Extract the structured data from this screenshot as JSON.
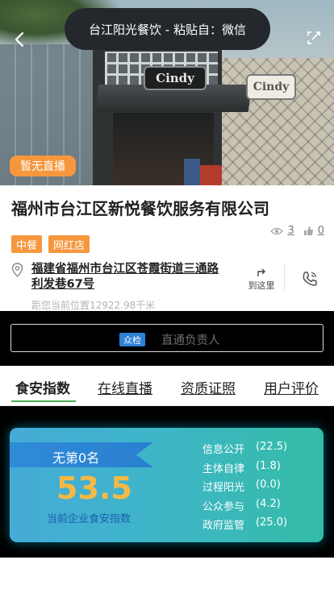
{
  "toast": {
    "text": "台江阳光餐饮 - 粘贴自：微信"
  },
  "hero": {
    "live_badge": "暂无直播",
    "sign_main": "Cindy",
    "sign_side": "Cindy"
  },
  "company": {
    "name": "福州市台江区新悦餐饮服务有限公司",
    "tags": [
      "中餐",
      "网红店"
    ],
    "views": "3",
    "likes": "0",
    "address": "福建省福州市台江区苍霞街道三通路利发巷67号",
    "directions_label": "到这里",
    "distance": "距您当前位置12922.98千米"
  },
  "responsible": {
    "badge": "众检",
    "label": "直通负责人"
  },
  "tabs": [
    {
      "label": "食安指数",
      "active": true
    },
    {
      "label": "在线直播",
      "active": false
    },
    {
      "label": "资质证照",
      "active": false
    },
    {
      "label": "用户评价",
      "active": false
    }
  ],
  "index": {
    "rank": "无第0名",
    "score": "53.5",
    "score_label": "当前企业食安指数",
    "metrics": [
      {
        "name": "信息公开",
        "value": "(22.5)"
      },
      {
        "name": "主体自律",
        "value": "(1.8)"
      },
      {
        "name": "过程阳光",
        "value": "(0.0)"
      },
      {
        "name": "公众参与",
        "value": "(4.2)"
      },
      {
        "name": "政府监管",
        "value": "(25.0)"
      }
    ]
  },
  "colors": {
    "accent_orange": "#f6973e",
    "tab_active": "#4caf50",
    "score_gold": "#f7b944",
    "badge_blue": "#2e7fd6"
  }
}
